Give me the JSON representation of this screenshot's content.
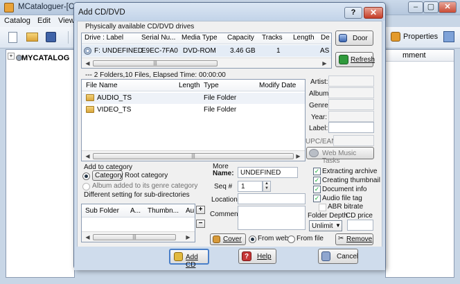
{
  "main": {
    "title": "MCataloguer-[C:\\U",
    "menu": [
      "Catalog",
      "Edit",
      "View"
    ],
    "tree_root": "MYCATALOG",
    "properties_label": "Properties",
    "right_header": "mment"
  },
  "dialog": {
    "title": "Add CD/DVD",
    "help_label": "?",
    "close_label": "✕",
    "drives_caption": "Physically available CD/DVD drives",
    "drive_columns": [
      "Drive : Label",
      "Serial Nu...",
      "Media Type",
      "Capacity",
      "Tracks",
      "Length",
      "De"
    ],
    "drive_row": {
      "drive": "F: UNDEFINED",
      "serial": "E9EC-7FA0",
      "media": "DVD-ROM",
      "capacity": "3.46 GB",
      "tracks": "1",
      "desc": "AS"
    },
    "door_label": "Door",
    "refresh_label": "Refresh",
    "status": "--- 2 Folders,10 Files, Elapsed Time: 00:00:00",
    "file_columns": [
      "File Name",
      "Length",
      "Type",
      "Modify Date"
    ],
    "files": [
      {
        "name": "AUDIO_TS",
        "type": "File Folder"
      },
      {
        "name": "VIDEO_TS",
        "type": "File Folder"
      }
    ],
    "meta_labels": [
      "Artist:",
      "Album:",
      "Genre:",
      "Year:",
      "Label:",
      "UPC/EAN:"
    ],
    "web_music_label": "Web Music Tasks",
    "add_to_category": "Add to category",
    "category_button": "Category",
    "root_category": "Root category",
    "album_genre_option": "Album added to its genre category",
    "different_setting": "Different setting for sub-directories",
    "sub_columns": [
      "Sub Folder",
      "A...",
      "Thumbn...",
      "Au"
    ],
    "plus_label": "+",
    "minus_label": "−",
    "more_label": "More",
    "name_label": "Name:",
    "name_value": "UNDEFINED",
    "seq_label": "Seq #",
    "seq_value": "1",
    "location_label": "Location:",
    "comment_label": "Comment:",
    "cover_label": "Cover",
    "from_web": "From web",
    "from_file": "From file",
    "checks": [
      "Extracting archive",
      "Creating thumbnail",
      "Document info",
      "Audio file tag",
      "ABR bitrate"
    ],
    "folder_depth_label": "Folder Depth",
    "folder_depth_value": "Unlimit",
    "cd_price_label": "CD price",
    "remove_label": "Remove",
    "add_cd_label": "Add CD",
    "help_button": "Help",
    "cancel_label": "Cancel"
  }
}
